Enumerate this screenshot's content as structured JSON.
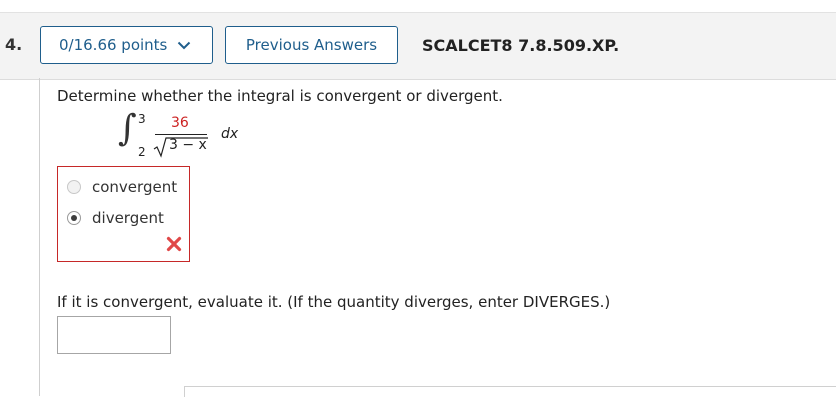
{
  "question": {
    "number": "4.",
    "points": "0/16.66 points",
    "previous_answers": "Previous Answers",
    "id": "SCALCET8 7.8.509.XP.",
    "prompt": "Determine whether the integral is convergent or divergent.",
    "integral": {
      "upper": "3",
      "lower": "2",
      "numerator": "36",
      "denominator": "3 − x",
      "differential": "dx"
    },
    "options": [
      {
        "label": "convergent",
        "checked": false
      },
      {
        "label": "divergent",
        "checked": true
      }
    ],
    "result": "incorrect",
    "evaluate_prompt": "If it is convergent, evaluate it. (If the quantity diverges, enter DIVERGES.)",
    "evaluate_value": ""
  },
  "colors": {
    "accent": "#1f5e8c",
    "error": "#c62828",
    "header_bg": "#f3f3f3"
  }
}
